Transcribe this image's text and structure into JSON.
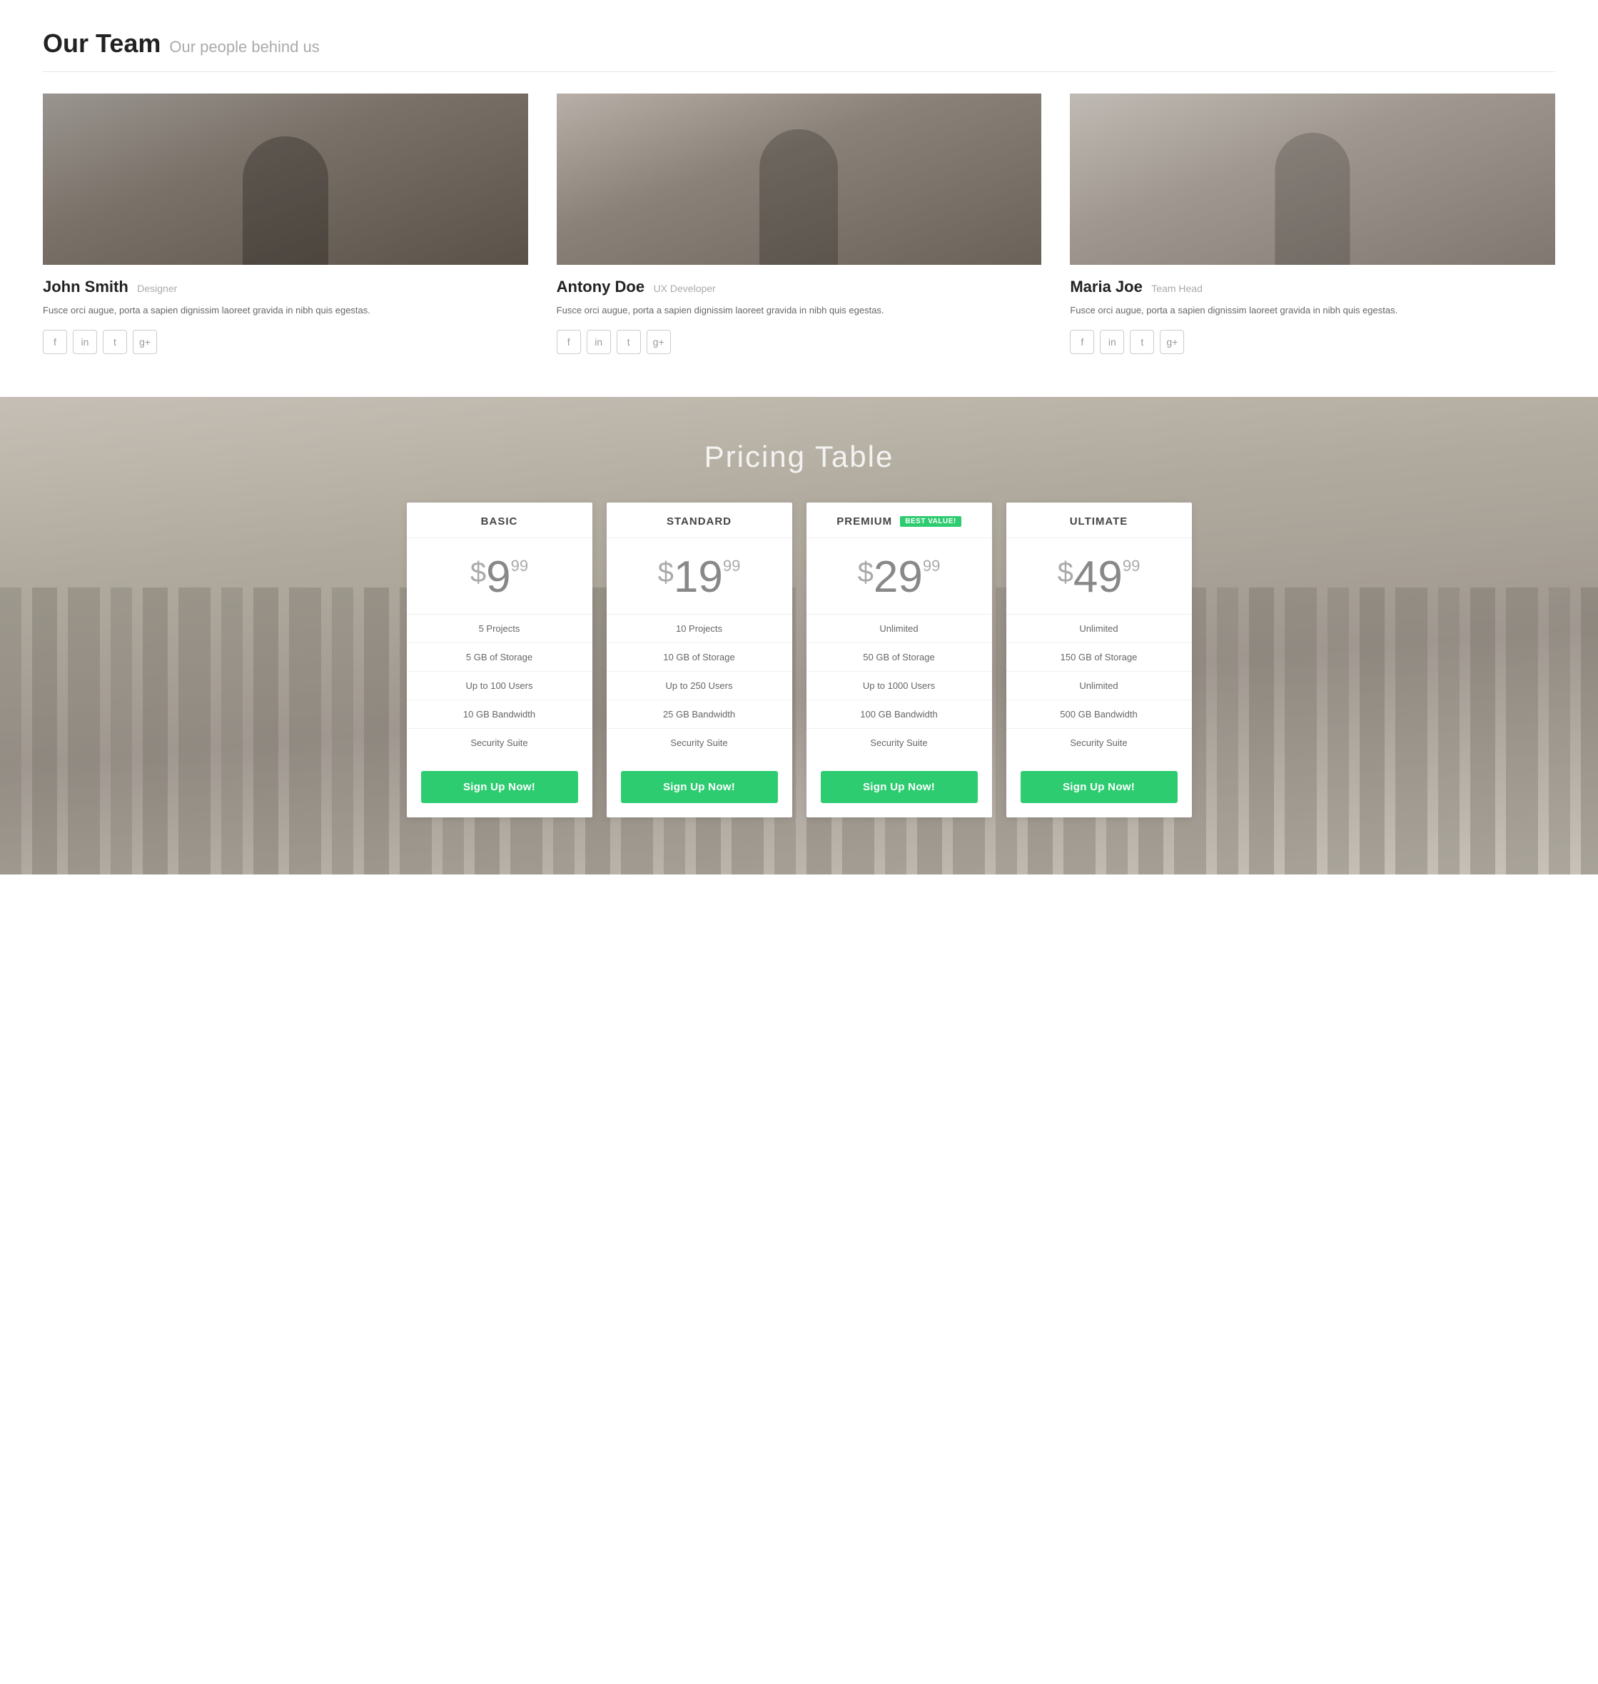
{
  "team": {
    "section_title": "Our Team",
    "section_subtitle": "Our people behind us",
    "members": [
      {
        "name": "John Smith",
        "role": "Designer",
        "bio": "Fusce orci augue, porta a sapien dignissim laoreet gravida in nibh quis egestas.",
        "photo_class": "photo-john",
        "social": [
          "f",
          "in",
          "t",
          "g+"
        ]
      },
      {
        "name": "Antony Doe",
        "role": "UX Developer",
        "bio": "Fusce orci augue, porta a sapien dignissim laoreet gravida in nibh quis egestas.",
        "photo_class": "photo-antony",
        "social": [
          "f",
          "in",
          "t",
          "g+"
        ]
      },
      {
        "name": "Maria Joe",
        "role": "Team Head",
        "bio": "Fusce orci augue, porta a sapien dignissim laoreet gravida in nibh quis egestas.",
        "photo_class": "photo-maria",
        "social": [
          "f",
          "in",
          "t",
          "g+"
        ]
      }
    ]
  },
  "pricing": {
    "section_title": "Pricing Table",
    "plans": [
      {
        "name": "BASIC",
        "best_value": false,
        "price_dollar": "$",
        "price_amount": "9",
        "price_cents": "99",
        "features": [
          "5 Projects",
          "5 GB of Storage",
          "Up to 100 Users",
          "10 GB Bandwidth",
          "Security Suite"
        ],
        "cta": "Sign Up Now!"
      },
      {
        "name": "STANDARD",
        "best_value": false,
        "price_dollar": "$",
        "price_amount": "19",
        "price_cents": "99",
        "features": [
          "10 Projects",
          "10 GB of Storage",
          "Up to 250 Users",
          "25 GB Bandwidth",
          "Security Suite"
        ],
        "cta": "Sign Up Now!"
      },
      {
        "name": "PREMIUM",
        "best_value": true,
        "best_value_label": "BEST VALUE!",
        "price_dollar": "$",
        "price_amount": "29",
        "price_cents": "99",
        "features": [
          "Unlimited",
          "50 GB of Storage",
          "Up to 1000 Users",
          "100 GB Bandwidth",
          "Security Suite"
        ],
        "cta": "Sign Up Now!"
      },
      {
        "name": "ULTIMATE",
        "best_value": false,
        "price_dollar": "$",
        "price_amount": "49",
        "price_cents": "99",
        "features": [
          "Unlimited",
          "150 GB of Storage",
          "Unlimited",
          "500 GB Bandwidth",
          "Security Suite"
        ],
        "cta": "Sign Up Now!"
      }
    ]
  },
  "social_icons": {
    "facebook": "f",
    "linkedin": "in",
    "twitter": "t",
    "googleplus": "g+"
  }
}
